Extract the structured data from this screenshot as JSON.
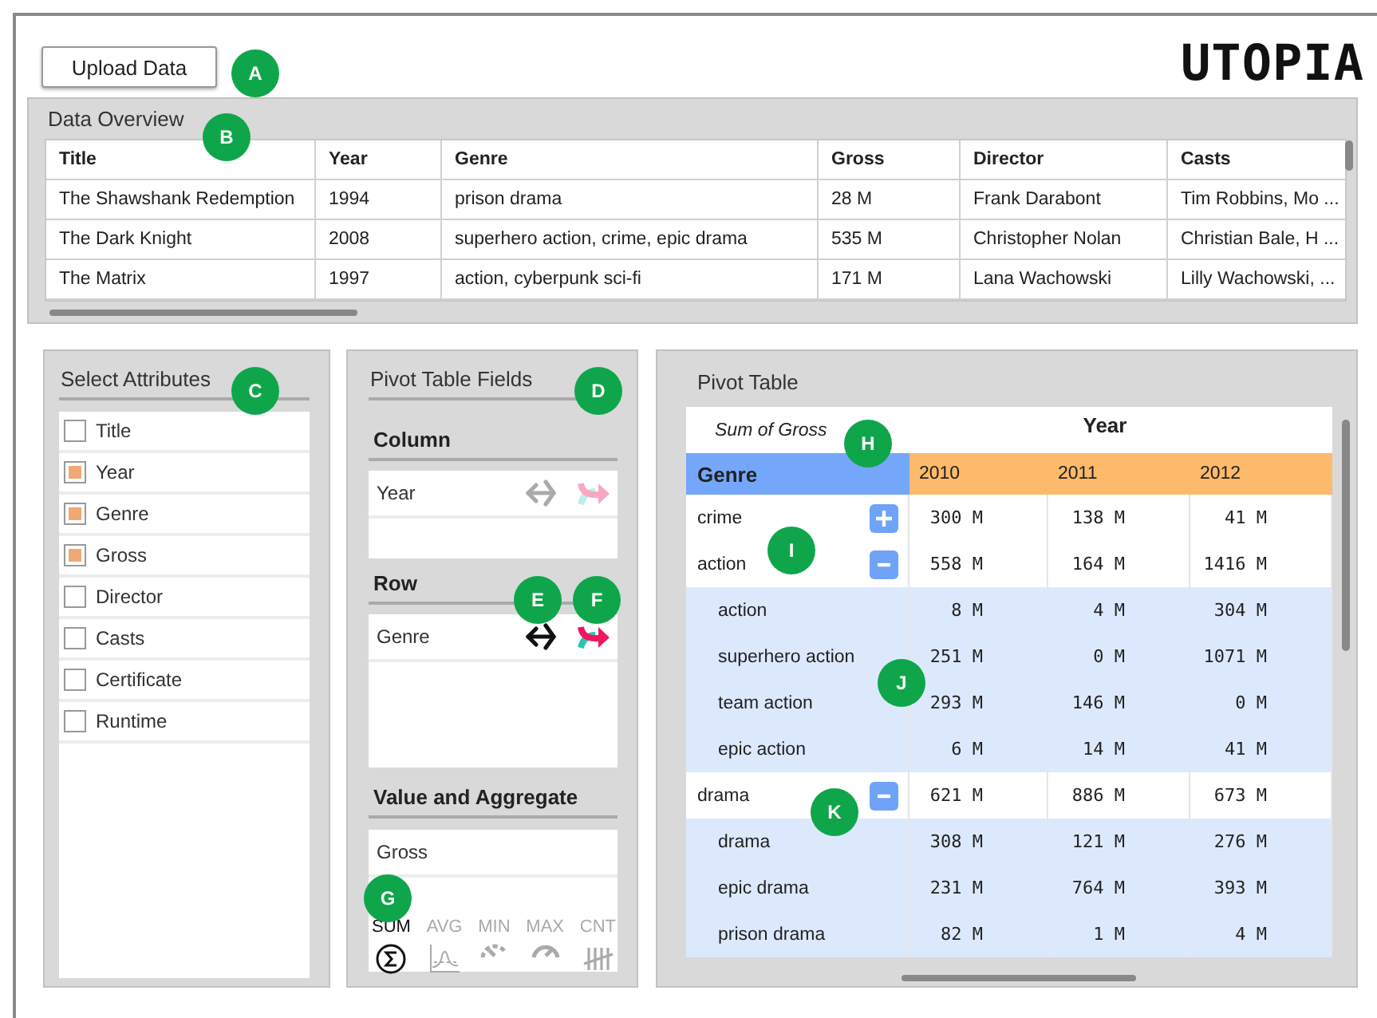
{
  "header": {
    "upload_button": "Upload Data",
    "logo": "UTOPIA"
  },
  "data_overview": {
    "title": "Data Overview",
    "columns": [
      "Title",
      "Year",
      "Genre",
      "Gross",
      "Director",
      "Casts"
    ],
    "rows": [
      [
        "The Shawshank Redemption",
        "1994",
        "prison drama",
        "28 M",
        "Frank Darabont",
        "Tim Robbins, Mo ..."
      ],
      [
        "The Dark Knight",
        "2008",
        "superhero action, crime, epic drama",
        "535 M",
        "Christopher Nolan",
        "Christian Bale, H ..."
      ],
      [
        "The Matrix",
        "1997",
        "action, cyberpunk sci-fi",
        "171 M",
        "Lana Wachowski",
        "Lilly Wachowski, ..."
      ]
    ]
  },
  "select_attributes": {
    "title": "Select Attributes",
    "items": [
      {
        "label": "Title",
        "checked": false
      },
      {
        "label": "Year",
        "checked": true
      },
      {
        "label": "Genre",
        "checked": true
      },
      {
        "label": "Gross",
        "checked": true
      },
      {
        "label": "Director",
        "checked": false
      },
      {
        "label": "Casts",
        "checked": false
      },
      {
        "label": "Certificate",
        "checked": false
      },
      {
        "label": "Runtime",
        "checked": false
      }
    ]
  },
  "pivot_fields": {
    "title": "Pivot Table Fields",
    "sections": [
      {
        "kind": "column",
        "title": "Column",
        "fields": [
          {
            "label": "Year",
            "active": false
          }
        ]
      },
      {
        "kind": "row",
        "title": "Row",
        "fields": [
          {
            "label": "Genre",
            "active": true
          }
        ]
      },
      {
        "kind": "value",
        "title": "Value and Aggregate",
        "fields": [
          {
            "label": "Gross"
          }
        ],
        "aggregates": [
          {
            "label": "SUM",
            "selected": true
          },
          {
            "label": "AVG",
            "selected": false
          },
          {
            "label": "MIN",
            "selected": false
          },
          {
            "label": "MAX",
            "selected": false
          },
          {
            "label": "CNT",
            "selected": false
          }
        ]
      }
    ]
  },
  "pivot_table": {
    "title": "Pivot Table",
    "value_label": "Sum of Gross",
    "column_field": "Year",
    "row_field": "Genre",
    "columns": [
      "2010",
      "2011",
      "2012"
    ],
    "rows": [
      {
        "label": "crime",
        "expanded": false,
        "values": [
          "300 M",
          "138 M",
          "41 M"
        ]
      },
      {
        "label": "action",
        "expanded": true,
        "values": [
          "558 M",
          "164 M",
          "1416 M"
        ],
        "children": [
          {
            "label": "action",
            "values": [
              "8 M",
              "4 M",
              "304 M"
            ]
          },
          {
            "label": "superhero action",
            "values": [
              "251 M",
              "0 M",
              "1071 M"
            ]
          },
          {
            "label": "team action",
            "values": [
              "293 M",
              "146 M",
              "0 M"
            ]
          },
          {
            "label": "epic action",
            "values": [
              "6 M",
              "14 M",
              "41 M"
            ]
          }
        ]
      },
      {
        "label": "drama",
        "expanded": true,
        "values": [
          "621 M",
          "886 M",
          "673 M"
        ],
        "children": [
          {
            "label": "drama",
            "values": [
              "308 M",
              "121 M",
              "276 M"
            ]
          },
          {
            "label": "epic drama",
            "values": [
              "231 M",
              "764 M",
              "393 M"
            ]
          },
          {
            "label": "prison drama",
            "values": [
              "82 M",
              "1 M",
              "4 M"
            ]
          }
        ]
      }
    ]
  },
  "markers": [
    {
      "label": "A"
    },
    {
      "label": "B"
    },
    {
      "label": "C"
    },
    {
      "label": "D"
    },
    {
      "label": "E"
    },
    {
      "label": "F"
    },
    {
      "label": "G"
    },
    {
      "label": "H"
    },
    {
      "label": "I"
    },
    {
      "label": "J"
    },
    {
      "label": "K"
    }
  ]
}
